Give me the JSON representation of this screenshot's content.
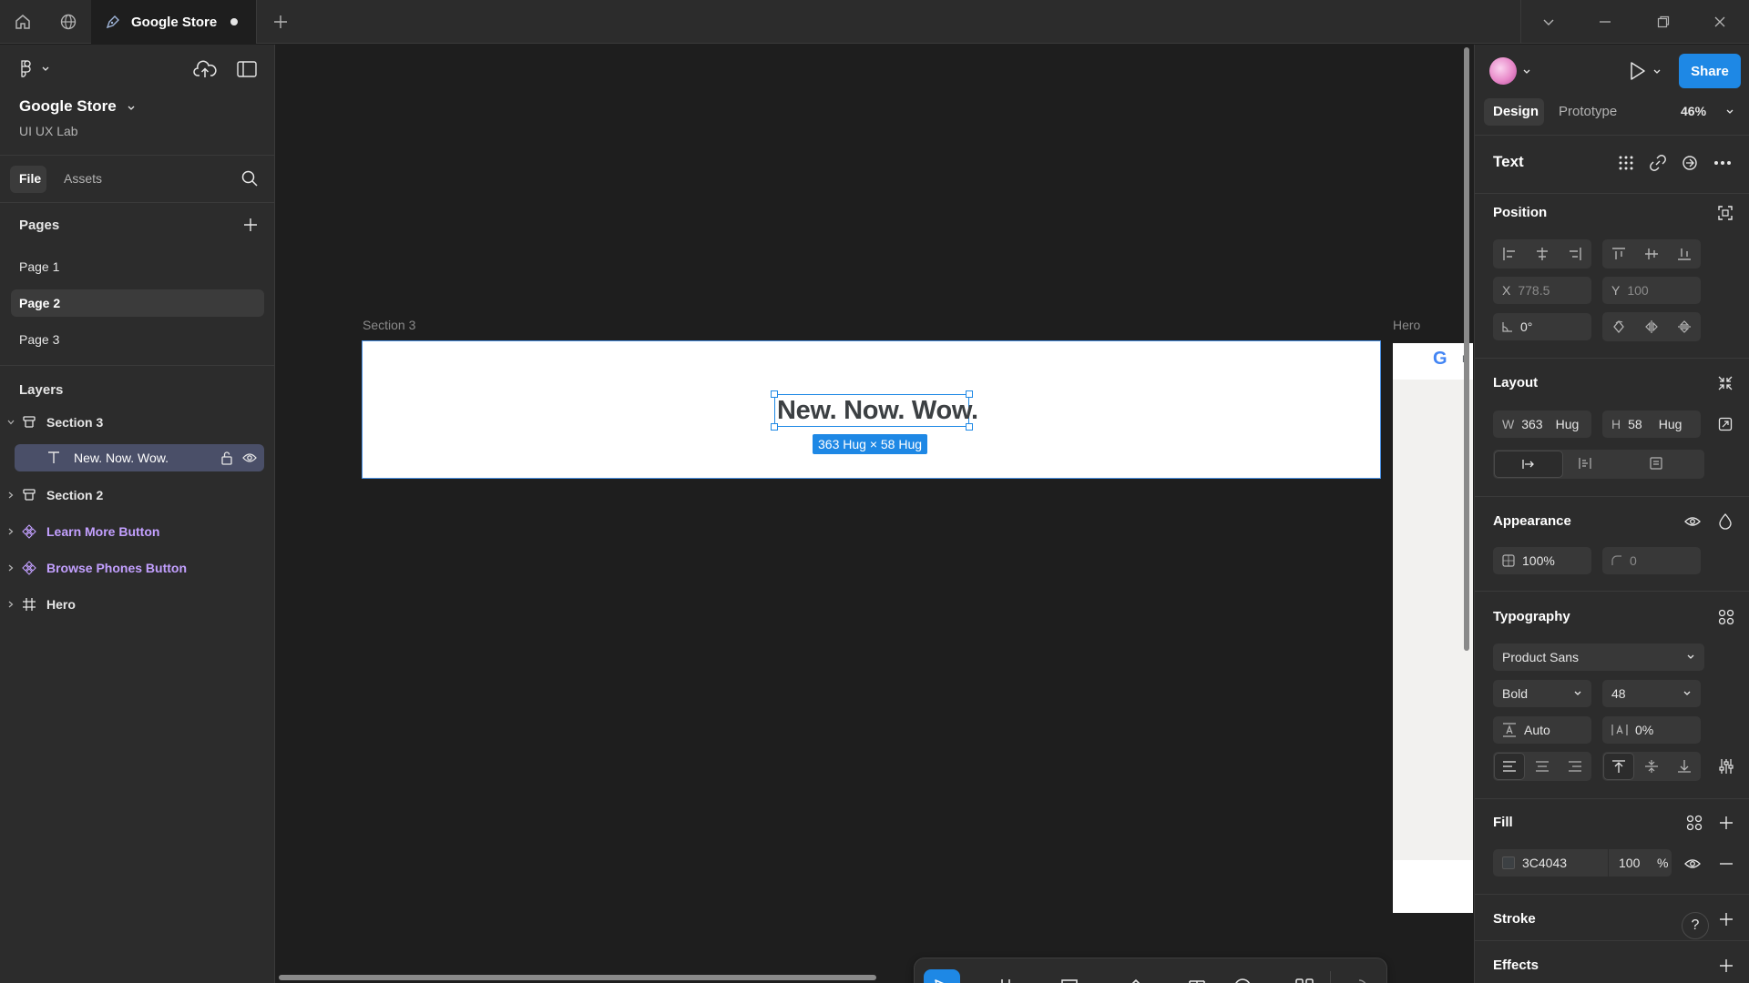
{
  "titlebar": {
    "tab_title": "Google Store",
    "icons": [
      "home-icon",
      "globe-icon",
      "pen-tool-icon",
      "plus-icon",
      "chevron-down-icon",
      "minimize-icon",
      "restore-icon",
      "close-icon"
    ]
  },
  "file": {
    "name": "Google Store",
    "team": "UI UX Lab"
  },
  "left_tabs": {
    "file": "File",
    "assets": "Assets"
  },
  "pages": {
    "title": "Pages",
    "items": [
      "Page 1",
      "Page 2",
      "Page 3"
    ],
    "selected": "Page 2"
  },
  "layers": {
    "title": "Layers",
    "items": [
      {
        "label": "Section 3",
        "kind": "section"
      },
      {
        "label": "New. Now. Wow.",
        "kind": "text"
      },
      {
        "label": "Section 2",
        "kind": "section"
      },
      {
        "label": "Learn More Button",
        "kind": "component"
      },
      {
        "label": "Browse Phones Button",
        "kind": "component"
      },
      {
        "label": "Hero",
        "kind": "frame"
      }
    ]
  },
  "canvas": {
    "section3_label": "Section 3",
    "hero_label": "Hero",
    "selected_text": "New. Now. Wow.",
    "size_badge": "363 Hug × 58 Hug",
    "hero_logo_text": "G",
    "hero_cut_text": "P"
  },
  "right": {
    "tabs": {
      "design": "Design",
      "prototype": "Prototype"
    },
    "zoom": "46%",
    "share": "Share",
    "selection_type": "Text",
    "position": {
      "title": "Position",
      "x_label": "X",
      "x": "778.5",
      "y_label": "Y",
      "y": "100",
      "rotation": "0°"
    },
    "layout": {
      "title": "Layout",
      "w_label": "W",
      "w": "363",
      "w_mode": "Hug",
      "h_label": "H",
      "h": "58",
      "h_mode": "Hug"
    },
    "appearance": {
      "title": "Appearance",
      "opacity": "100%",
      "radius": "0"
    },
    "typography": {
      "title": "Typography",
      "font": "Product Sans",
      "weight": "Bold",
      "size": "48",
      "line_height": "Auto",
      "letter_spacing": "0%"
    },
    "fill": {
      "title": "Fill",
      "hex": "3C4043",
      "opacity": "100",
      "pct": "%"
    },
    "stroke": {
      "title": "Stroke"
    },
    "effects": {
      "title": "Effects"
    },
    "help": "?"
  },
  "colors": {
    "accent": "#1e88e5",
    "component_purple": "#c3a0ff",
    "text_fill": "#3c4043"
  }
}
